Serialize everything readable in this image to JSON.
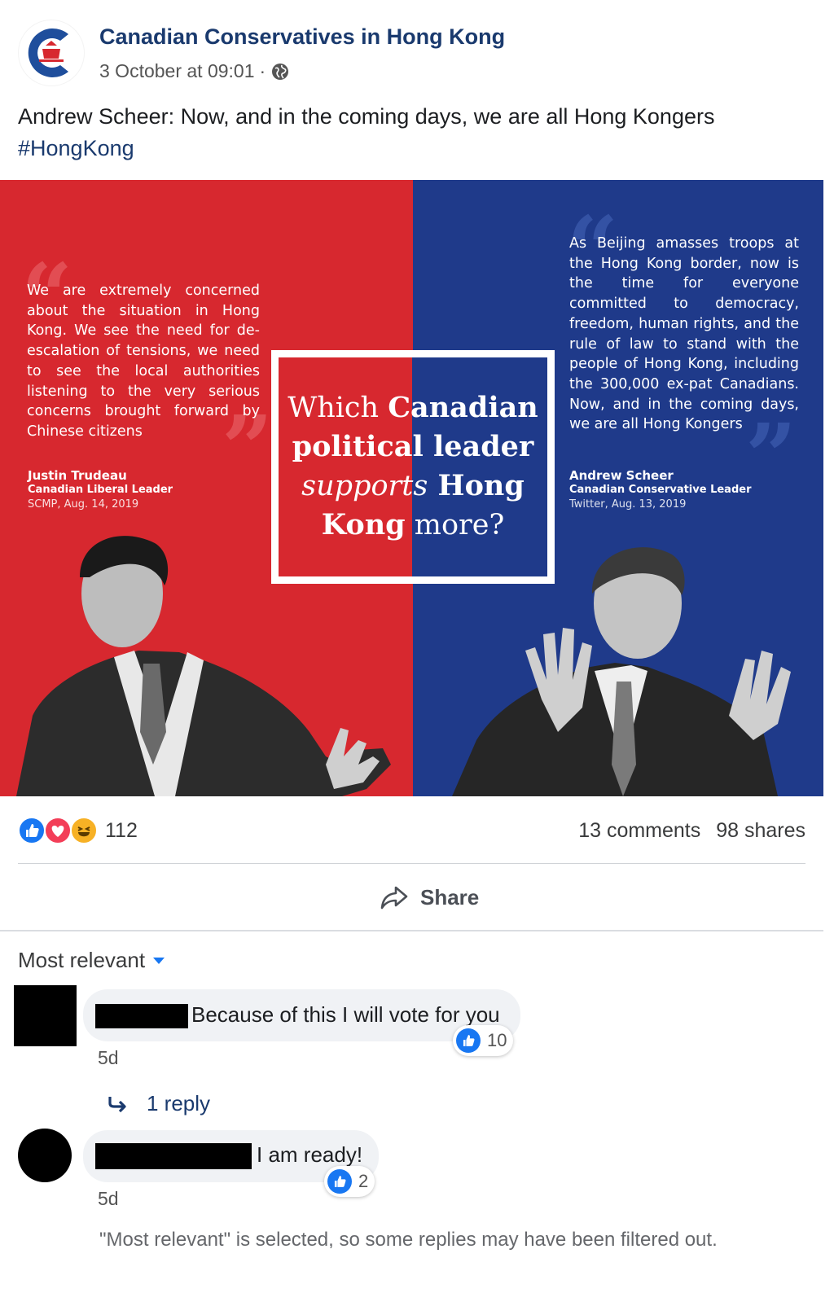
{
  "post": {
    "page_name": "Canadian Conservatives in Hong Kong",
    "timestamp": "3 October at 09:01",
    "separator": "·",
    "audience_icon": "globe-icon",
    "text": "Andrew Scheer: Now, and in the coming days, we are all Hong Kongers",
    "hashtag": "#HongKong"
  },
  "image": {
    "left_quote": "We are extremely concerned about the situation in Hong Kong. We see the need for de-escalation of tensions, we need to see the local authorities listening to the very serious concerns brought forward by Chinese citizens",
    "left_name": "Justin Trudeau",
    "left_role": "Canadian Liberal Leader",
    "left_source": "SCMP, Aug. 14, 2019",
    "right_quote": "As Beijing amasses troops at the Hong Kong border, now is the time for everyone committed to democracy, freedom, human rights, and the rule of law to stand with the people of Hong Kong, including the 300,000 ex-pat Canadians. Now, and in the coming days, we are all Hong Kongers",
    "right_name": "Andrew Scheer",
    "right_role": "Canadian Conservative Leader",
    "right_source": "Twitter, Aug. 13, 2019",
    "center_line1_a": "Which ",
    "center_line1_b": "Canadian",
    "center_line2": "political leader",
    "center_line3_a": "supports",
    "center_line3_b": " Hong",
    "center_line4_a": "Kong",
    "center_line4_b": " more?",
    "colors": {
      "red": "#d7282f",
      "blue": "#1f3a8a"
    }
  },
  "engagement": {
    "reaction_icons": [
      "like-icon",
      "love-icon",
      "haha-icon"
    ],
    "reaction_count": "112",
    "comments": "13 comments",
    "shares": "98 shares",
    "share_label": "Share"
  },
  "comments": {
    "sort_label": "Most relevant",
    "items": [
      {
        "text": "Because of this I will vote for you",
        "likes": "10",
        "time": "5d"
      },
      {
        "text": "I am ready!",
        "likes": "2",
        "time": "5d"
      }
    ],
    "reply_label": "1 reply",
    "filter_note": "\"Most relevant\" is selected, so some replies may have been filtered out."
  }
}
